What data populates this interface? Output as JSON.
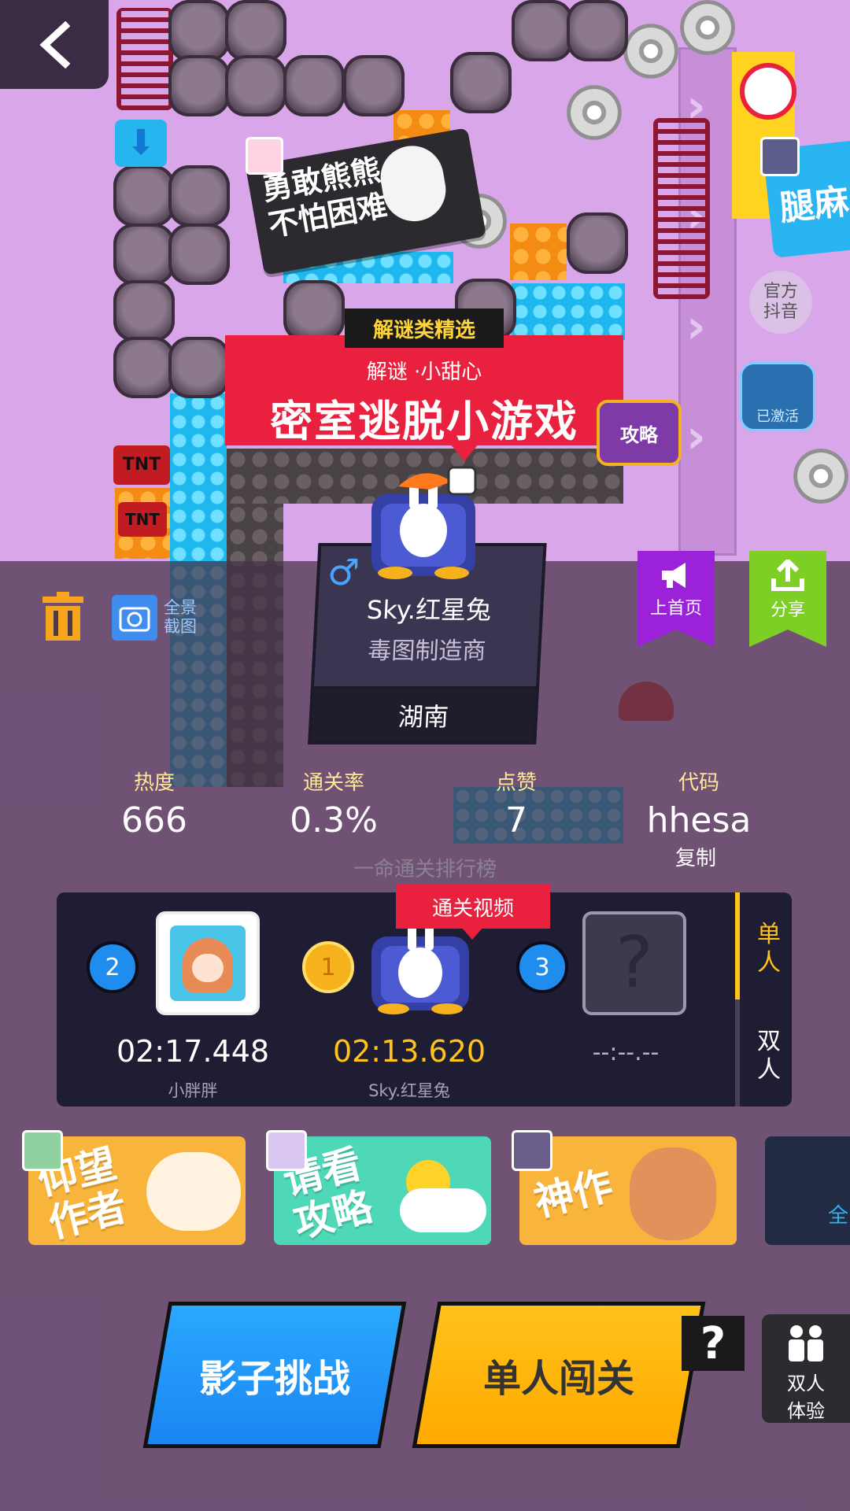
{
  "nav": {
    "back_icon": "back-arrow-icon"
  },
  "stickers": [
    {
      "text_line1": "勇敢熊熊",
      "text_line2": "不怕困难"
    },
    {
      "text": "腿麻"
    }
  ],
  "official_badge": {
    "line1": "官方",
    "line2": "抖音"
  },
  "activated_badge": "已激活",
  "guide_tv": "攻略",
  "level": {
    "category_tag": "解谜类精选",
    "subtitle": "解谜 ·小甜心",
    "title": "密室逃脱小游戏"
  },
  "author": {
    "name": "Sky.红星兔",
    "title": "毒图制造商",
    "region": "湖南",
    "gender_icon": "male-icon"
  },
  "tools": {
    "screenshot_label_line1": "全景",
    "screenshot_label_line2": "截图"
  },
  "actions": {
    "homepage": "上首页",
    "share": "分享"
  },
  "stats": {
    "heat_label": "热度",
    "heat_value": "666",
    "clear_rate_label": "通关率",
    "clear_rate_value": "0.3%",
    "likes_label": "点赞",
    "likes_value": "7",
    "code_label": "代码",
    "code_value": "hhesa",
    "copy_label": "复制"
  },
  "leaderboard": {
    "title": "一命通关排行榜",
    "clear_video": "通关视频",
    "tab_single": "单人",
    "tab_double": "双人",
    "entries": [
      {
        "rank": "2",
        "time": "02:17.448",
        "name": "小胖胖"
      },
      {
        "rank": "1",
        "time": "02:13.620",
        "name": "Sky.红星兔"
      },
      {
        "rank": "3",
        "time": "--:--.--",
        "name": ""
      }
    ]
  },
  "reactions": [
    {
      "label": "仰望作者",
      "line1": "仰望",
      "line2": "作者"
    },
    {
      "label": "请看攻略",
      "line1": "请看",
      "line2": "攻略"
    },
    {
      "label": "神作",
      "line1": "神作",
      "line2": ""
    },
    {
      "label": "全",
      "line1": "全",
      "line2": ""
    }
  ],
  "buttons": {
    "shadow_challenge": "影子挑战",
    "solo": "单人闯关",
    "help": "?",
    "duo_line1": "双人",
    "duo_line2": "体验"
  },
  "colors": {
    "title_red": "#e9213f",
    "gold": "#ffc31a",
    "blue": "#1a86f2",
    "purple": "#9b22d8",
    "green": "#7dcf25"
  }
}
